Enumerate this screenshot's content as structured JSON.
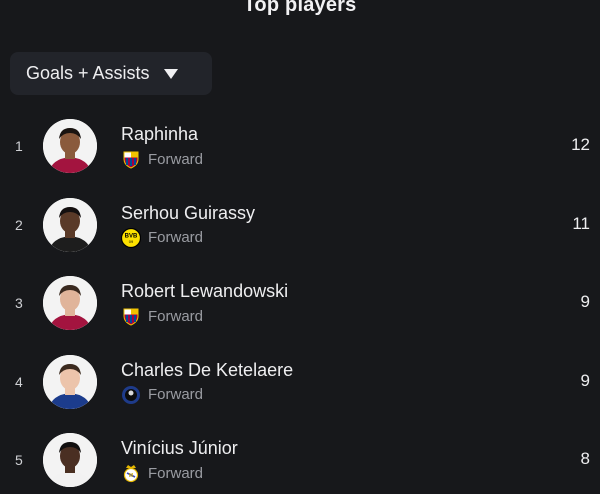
{
  "title": "Top players",
  "filter": {
    "label": "Goals + Assists"
  },
  "players": [
    {
      "rank": "1",
      "name": "Raphinha",
      "position": "Forward",
      "club_icon": "barcelona-crest-icon",
      "value": "12",
      "skin": "#8a5a3c",
      "hair": "#1a1411",
      "kit": "#a3143f"
    },
    {
      "rank": "2",
      "name": "Serhou Guirassy",
      "position": "Forward",
      "club_icon": "dortmund-crest-icon",
      "value": "11",
      "skin": "#5a3a28",
      "hair": "#141010",
      "kit": "#1d1d1d"
    },
    {
      "rank": "3",
      "name": "Robert Lewandowski",
      "position": "Forward",
      "club_icon": "barcelona-crest-icon",
      "value": "9",
      "skin": "#e0b49a",
      "hair": "#3a2a20",
      "kit": "#a3143f"
    },
    {
      "rank": "4",
      "name": "Charles De Ketelaere",
      "position": "Forward",
      "club_icon": "atalanta-crest-icon",
      "value": "9",
      "skin": "#ecc4ab",
      "hair": "#3b2a1e",
      "kit": "#1c3c8c"
    },
    {
      "rank": "5",
      "name": "Vinícius Júnior",
      "position": "Forward",
      "club_icon": "real-madrid-crest-icon",
      "value": "8",
      "skin": "#4a2f22",
      "hair": "#121010",
      "kit": "#f2f2f2"
    }
  ]
}
